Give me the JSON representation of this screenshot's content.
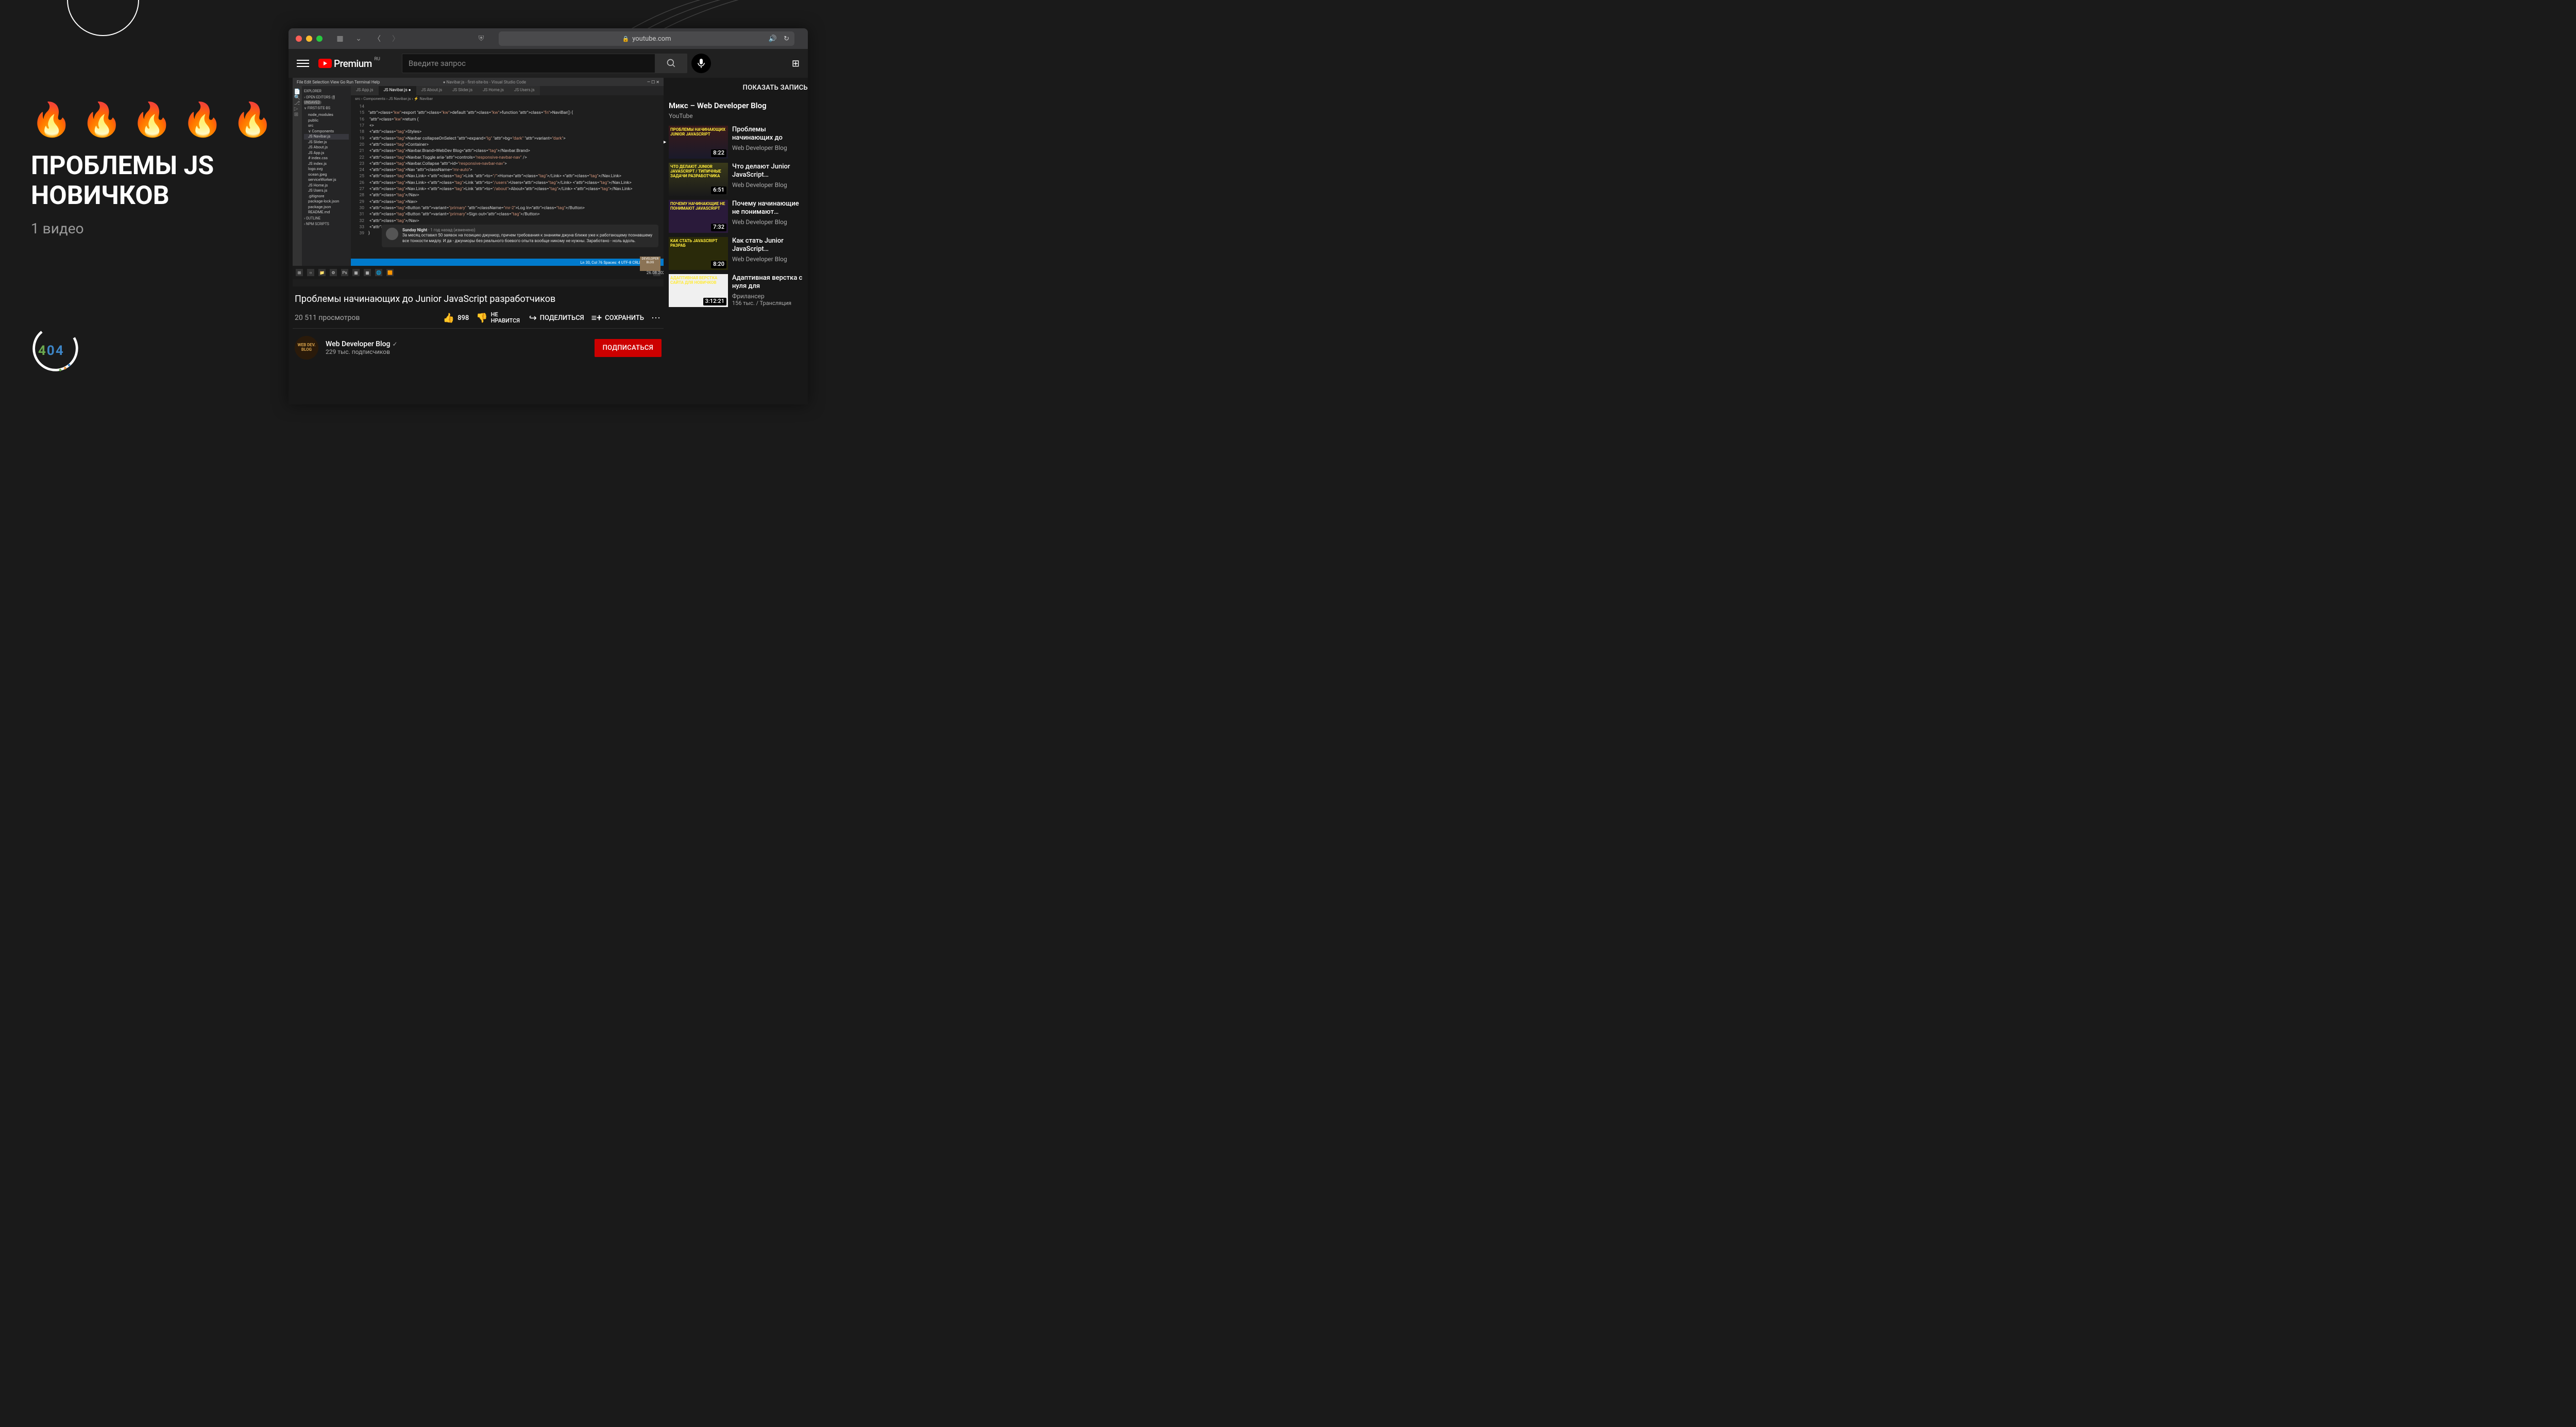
{
  "left": {
    "fires": "🔥🔥🔥🔥🔥",
    "title_l1": "ПРОБЛЕМЫ JS",
    "title_l2": "НОВИЧКОВ",
    "subtitle": "1 видео",
    "logo": {
      "d1": "4",
      "d2": "0",
      "d3": "4"
    }
  },
  "browser": {
    "url": "youtube.com"
  },
  "yt": {
    "logo_text": "Premium",
    "country": "RU",
    "search_placeholder": "Введите запрос"
  },
  "vscode": {
    "menu": [
      "File",
      "Edit",
      "Selection",
      "View",
      "Go",
      "Run",
      "Terminal",
      "Help"
    ],
    "win_title": "● Navibar.js - first-site-bs - Visual Studio Code",
    "explorer_label": "EXPLORER",
    "open_editors": "OPEN EDITORS",
    "unsaved": "1 UNSAVED",
    "project": "FIRST-SITE-BS",
    "files": [
      "node_modules",
      "public",
      "src",
      "∨ Components",
      "JS Navibar.js",
      "JS Slider.js",
      "JS About.js",
      "JS App.js",
      "# index.css",
      "JS index.js",
      "logo.svg",
      "ocean.jpeg",
      "serviceWorker.js",
      "JS Home.js",
      "JS Users.js",
      ".gitignore",
      "package-lock.json",
      "package.json",
      "README.md"
    ],
    "outline": "OUTLINE",
    "npm": "NPM SCRIPTS",
    "tabs": [
      "JS App.js",
      "JS Navibar.js ●",
      "JS About.js",
      "JS Slider.js",
      "JS Home.js",
      "JS Users.js"
    ],
    "active_tab": 1,
    "breadcrumbs": "src › Components › JS Navibar.js › ⚡ Navibar",
    "code_lines": [
      {
        "n": 14,
        "t": ""
      },
      {
        "n": 15,
        "t": "export default function NaviBar() {",
        "cls": [
          "kw",
          "kw",
          "fn"
        ]
      },
      {
        "n": 16,
        "t": "    return ("
      },
      {
        "n": 17,
        "t": "        <>"
      },
      {
        "n": 18,
        "t": "            <Styles>"
      },
      {
        "n": 19,
        "t": "                <Navbar collapseOnSelect expand=\"lg\" bg=\"dark\" variant=\"dark\">"
      },
      {
        "n": 20,
        "t": "                    <Container>"
      },
      {
        "n": 21,
        "t": "                        <Navbar.Brand>WebDev Blog</Navbar.Brand>"
      },
      {
        "n": 22,
        "t": "                        <Navbar.Toggle aria-controls=\"responsive-navbar-nav\" />"
      },
      {
        "n": 23,
        "t": "                        <Navbar.Collapse id=\"responsive-navbar-nav\">"
      },
      {
        "n": 24,
        "t": "                            <Nav className=\"mr-auto\">"
      },
      {
        "n": 25,
        "t": "                                <Nav.Link> <Link to=\"/\">Home</Link> </Nav.Link>"
      },
      {
        "n": 26,
        "t": "                                <Nav.Link> <Link to=\"/users\">Users</Link> </Nav.Link>"
      },
      {
        "n": 27,
        "t": "                                <Nav.Link> <Link to=\"/about\">About</Link> </Nav.Link>"
      },
      {
        "n": 28,
        "t": "                            </Nav>"
      },
      {
        "n": 29,
        "t": "                            <Nav>"
      },
      {
        "n": 30,
        "t": "                                <Button variant=\"primary\" className=\"mr-2\">Log In</Button>"
      },
      {
        "n": 31,
        "t": "                                <Button variant=\"primary\">Sign out</Button>"
      },
      {
        "n": 32,
        "t": "                            </Nav>"
      },
      {
        "n": 33,
        "t": "                        </Navbar.Collapse>"
      },
      {
        "n": 39,
        "t": "}"
      }
    ],
    "comment": {
      "author": "Sunday Night",
      "time": "1 год назад (изменено)",
      "text": "За месяц оставил 50 заявок на позицию джуниор, причем требования к знаниям джуна ближе уже к работающему познавшему все тонкости мидлу. И да - джуниоры без реального боевого опыта вообще никому не нужны. Заработано - ноль вдоль."
    },
    "status": "Ln 30, Col 76   Spaces: 4   UTF-8   CRLF   JavaScript",
    "task_date": "26.08.2020",
    "badge": "DEVELOPER BLOG"
  },
  "video": {
    "title": "Проблемы начинающих до Junior JavaScript разработчиков",
    "views": "20 511 просмотров",
    "likes": "898",
    "dislike_label": "НЕ НРАВИТСЯ",
    "share": "ПОДЕЛИТЬСЯ",
    "save": "СОХРАНИТЬ",
    "channel_name": "Web Developer Blog",
    "channel_logo": "WEB DEV. BLOG",
    "subscribers": "229 тыс. подписчиков",
    "subscribe": "ПОДПИСАТЬСЯ"
  },
  "sidebar": {
    "show_chat": "ПОКАЗАТЬ ЗАПИСЬ",
    "mix_title": "Микс – Web Developer Blog",
    "mix_source": "YouTube",
    "items": [
      {
        "title": "Проблемы начинающих до",
        "channel": "Web Developer Blog",
        "dur": "8:22",
        "playing": true,
        "thumb_text": "ПРОБЛЕМЫ НАЧИНАЮЩИХ JUNIOR JAVASCRIPT"
      },
      {
        "title": "Что делают Junior JavaScript…",
        "channel": "Web Developer Blog",
        "dur": "6:51",
        "thumb_text": "ЧТО ДЕЛАЮТ JUNIOR JAVASCRIPT / ТИПИЧНЫЕ ЗАДАЧИ РАЗРАБОТЧИКА"
      },
      {
        "title": "Почему начинающие не понимают…",
        "channel": "Web Developer Blog",
        "dur": "7:32",
        "thumb_text": "ПОЧЕМУ НАЧИНАЮЩИЕ НЕ ПОНИМАЮТ JAVASCRIPT"
      },
      {
        "title": "Как стать Junior JavaScript…",
        "channel": "Web Developer Blog",
        "dur": "8:20",
        "thumb_text": "КАК СТАТЬ JAVASCRIPT РАЗРАБ"
      },
      {
        "title": "Адаптивная верстка с нуля для",
        "channel": "Фрилансер",
        "dur": "3:12:21",
        "extra": "156 тыс. / Трансляция",
        "thumb_text": "АДАПТИВНАЯ ВЕРСТКА САЙТА ДЛЯ НОВИЧКОВ"
      }
    ]
  }
}
